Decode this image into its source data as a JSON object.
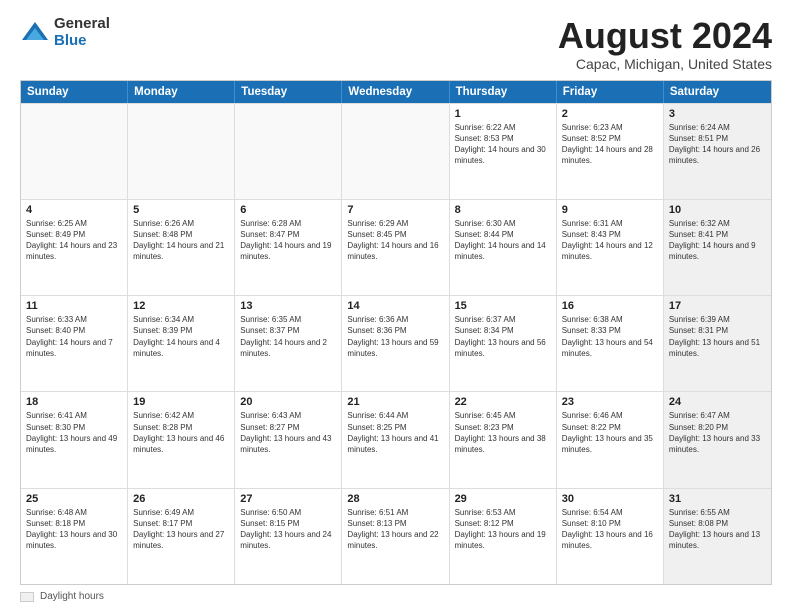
{
  "header": {
    "logo_general": "General",
    "logo_blue": "Blue",
    "main_title": "August 2024",
    "subtitle": "Capac, Michigan, United States"
  },
  "calendar": {
    "days_of_week": [
      "Sunday",
      "Monday",
      "Tuesday",
      "Wednesday",
      "Thursday",
      "Friday",
      "Saturday"
    ],
    "weeks": [
      [
        {
          "day": "",
          "empty": true
        },
        {
          "day": "",
          "empty": true
        },
        {
          "day": "",
          "empty": true
        },
        {
          "day": "",
          "empty": true
        },
        {
          "day": "1",
          "sunrise": "6:22 AM",
          "sunset": "8:53 PM",
          "daylight": "14 hours and 30 minutes."
        },
        {
          "day": "2",
          "sunrise": "6:23 AM",
          "sunset": "8:52 PM",
          "daylight": "14 hours and 28 minutes."
        },
        {
          "day": "3",
          "sunrise": "6:24 AM",
          "sunset": "8:51 PM",
          "daylight": "14 hours and 26 minutes.",
          "shaded": true
        }
      ],
      [
        {
          "day": "4",
          "sunrise": "6:25 AM",
          "sunset": "8:49 PM",
          "daylight": "14 hours and 23 minutes."
        },
        {
          "day": "5",
          "sunrise": "6:26 AM",
          "sunset": "8:48 PM",
          "daylight": "14 hours and 21 minutes."
        },
        {
          "day": "6",
          "sunrise": "6:28 AM",
          "sunset": "8:47 PM",
          "daylight": "14 hours and 19 minutes."
        },
        {
          "day": "7",
          "sunrise": "6:29 AM",
          "sunset": "8:45 PM",
          "daylight": "14 hours and 16 minutes."
        },
        {
          "day": "8",
          "sunrise": "6:30 AM",
          "sunset": "8:44 PM",
          "daylight": "14 hours and 14 minutes."
        },
        {
          "day": "9",
          "sunrise": "6:31 AM",
          "sunset": "8:43 PM",
          "daylight": "14 hours and 12 minutes."
        },
        {
          "day": "10",
          "sunrise": "6:32 AM",
          "sunset": "8:41 PM",
          "daylight": "14 hours and 9 minutes.",
          "shaded": true
        }
      ],
      [
        {
          "day": "11",
          "sunrise": "6:33 AM",
          "sunset": "8:40 PM",
          "daylight": "14 hours and 7 minutes."
        },
        {
          "day": "12",
          "sunrise": "6:34 AM",
          "sunset": "8:39 PM",
          "daylight": "14 hours and 4 minutes."
        },
        {
          "day": "13",
          "sunrise": "6:35 AM",
          "sunset": "8:37 PM",
          "daylight": "14 hours and 2 minutes."
        },
        {
          "day": "14",
          "sunrise": "6:36 AM",
          "sunset": "8:36 PM",
          "daylight": "13 hours and 59 minutes."
        },
        {
          "day": "15",
          "sunrise": "6:37 AM",
          "sunset": "8:34 PM",
          "daylight": "13 hours and 56 minutes."
        },
        {
          "day": "16",
          "sunrise": "6:38 AM",
          "sunset": "8:33 PM",
          "daylight": "13 hours and 54 minutes."
        },
        {
          "day": "17",
          "sunrise": "6:39 AM",
          "sunset": "8:31 PM",
          "daylight": "13 hours and 51 minutes.",
          "shaded": true
        }
      ],
      [
        {
          "day": "18",
          "sunrise": "6:41 AM",
          "sunset": "8:30 PM",
          "daylight": "13 hours and 49 minutes."
        },
        {
          "day": "19",
          "sunrise": "6:42 AM",
          "sunset": "8:28 PM",
          "daylight": "13 hours and 46 minutes."
        },
        {
          "day": "20",
          "sunrise": "6:43 AM",
          "sunset": "8:27 PM",
          "daylight": "13 hours and 43 minutes."
        },
        {
          "day": "21",
          "sunrise": "6:44 AM",
          "sunset": "8:25 PM",
          "daylight": "13 hours and 41 minutes."
        },
        {
          "day": "22",
          "sunrise": "6:45 AM",
          "sunset": "8:23 PM",
          "daylight": "13 hours and 38 minutes."
        },
        {
          "day": "23",
          "sunrise": "6:46 AM",
          "sunset": "8:22 PM",
          "daylight": "13 hours and 35 minutes."
        },
        {
          "day": "24",
          "sunrise": "6:47 AM",
          "sunset": "8:20 PM",
          "daylight": "13 hours and 33 minutes.",
          "shaded": true
        }
      ],
      [
        {
          "day": "25",
          "sunrise": "6:48 AM",
          "sunset": "8:18 PM",
          "daylight": "13 hours and 30 minutes."
        },
        {
          "day": "26",
          "sunrise": "6:49 AM",
          "sunset": "8:17 PM",
          "daylight": "13 hours and 27 minutes."
        },
        {
          "day": "27",
          "sunrise": "6:50 AM",
          "sunset": "8:15 PM",
          "daylight": "13 hours and 24 minutes."
        },
        {
          "day": "28",
          "sunrise": "6:51 AM",
          "sunset": "8:13 PM",
          "daylight": "13 hours and 22 minutes."
        },
        {
          "day": "29",
          "sunrise": "6:53 AM",
          "sunset": "8:12 PM",
          "daylight": "13 hours and 19 minutes."
        },
        {
          "day": "30",
          "sunrise": "6:54 AM",
          "sunset": "8:10 PM",
          "daylight": "13 hours and 16 minutes."
        },
        {
          "day": "31",
          "sunrise": "6:55 AM",
          "sunset": "8:08 PM",
          "daylight": "13 hours and 13 minutes.",
          "shaded": true
        }
      ]
    ]
  },
  "footer": {
    "legend_label": "Daylight hours"
  }
}
